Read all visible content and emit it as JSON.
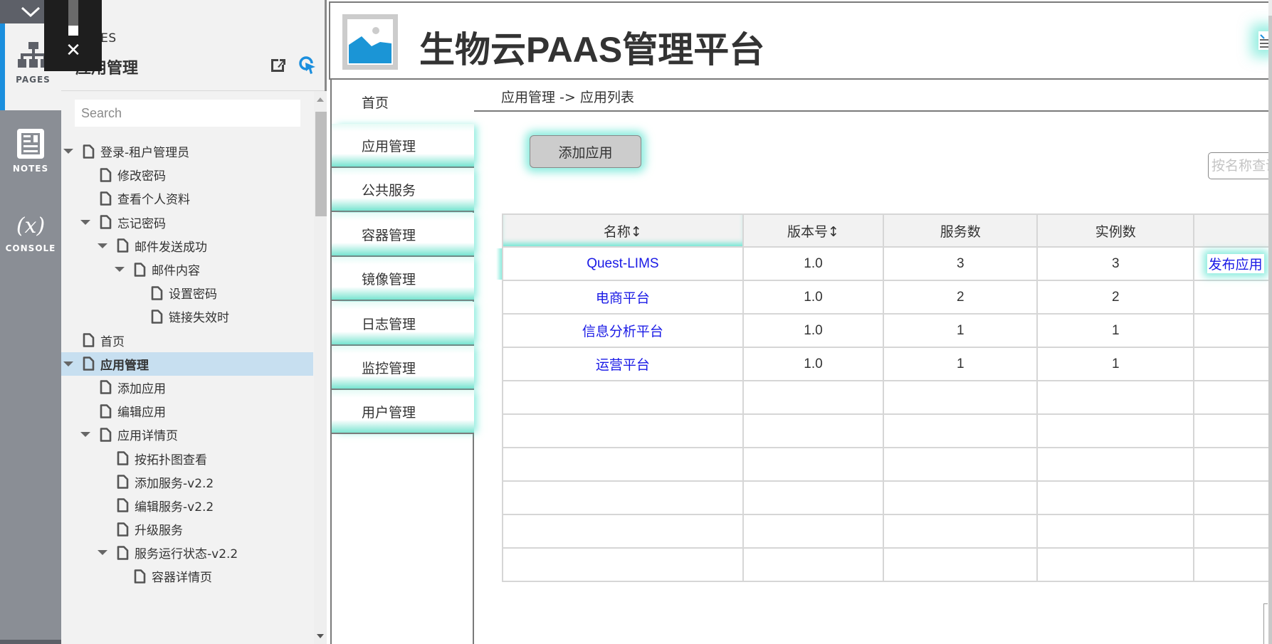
{
  "rail": {
    "tabs": [
      {
        "label": "PAGES",
        "icon": "sitemap-icon",
        "active": true
      },
      {
        "label": "NOTES",
        "icon": "notes-icon",
        "active": false
      },
      {
        "label": "CONSOLE",
        "icon": "variable-icon",
        "glyph": "(x)",
        "active": false
      }
    ]
  },
  "overlay": {
    "close_glyph": "✕"
  },
  "panel": {
    "kicker": "PAGES",
    "title": "应用管理",
    "search_placeholder": "Search",
    "tree": [
      {
        "label": "登录-租户管理员",
        "level": 0,
        "expanded": true
      },
      {
        "label": "修改密码",
        "level": 1
      },
      {
        "label": "查看个人资料",
        "level": 1
      },
      {
        "label": "忘记密码",
        "level": 1,
        "expanded": true
      },
      {
        "label": "邮件发送成功",
        "level": 2,
        "expanded": true
      },
      {
        "label": "邮件内容",
        "level": 3,
        "expanded": true
      },
      {
        "label": "设置密码",
        "level": 4
      },
      {
        "label": "链接失效时",
        "level": 4
      },
      {
        "label": "首页",
        "level": 0
      },
      {
        "label": "应用管理",
        "level": 0,
        "expanded": true,
        "selected": true
      },
      {
        "label": "添加应用",
        "level": 1
      },
      {
        "label": "编辑应用",
        "level": 1
      },
      {
        "label": "应用详情页",
        "level": 1,
        "expanded": true
      },
      {
        "label": "按拓扑图查看",
        "level": 2
      },
      {
        "label": "添加服务-v2.2",
        "level": 2
      },
      {
        "label": "编辑服务-v2.2",
        "level": 2
      },
      {
        "label": "升级服务",
        "level": 2
      },
      {
        "label": "服务运行状态-v2.2",
        "level": 2,
        "expanded": true
      },
      {
        "label": "容器详情页",
        "level": 3
      }
    ]
  },
  "app": {
    "title": "生物云PAAS管理平台",
    "nav": [
      {
        "label": "首页"
      },
      {
        "label": "应用管理"
      },
      {
        "label": "公共服务"
      },
      {
        "label": "容器管理"
      },
      {
        "label": "镜像管理"
      },
      {
        "label": "日志管理"
      },
      {
        "label": "监控管理"
      },
      {
        "label": "用户管理"
      }
    ],
    "breadcrumb": "应用管理 -> 应用列表",
    "add_button": "添加应用",
    "search_placeholder": "按名称查询",
    "table": {
      "columns": [
        "名称↕",
        "版本号↕",
        "服务数",
        "实例数",
        ""
      ],
      "rows": [
        {
          "name": "Quest-LIMS",
          "version": "1.0",
          "services": "3",
          "instances": "3",
          "action": "发布应用"
        },
        {
          "name": "电商平台",
          "version": "1.0",
          "services": "2",
          "instances": "2",
          "action": ""
        },
        {
          "name": "信息分析平台",
          "version": "1.0",
          "services": "1",
          "instances": "1",
          "action": ""
        },
        {
          "name": "运营平台",
          "version": "1.0",
          "services": "1",
          "instances": "1",
          "action": ""
        }
      ],
      "empty_rows": 6
    }
  },
  "colors": {
    "accent_blue": "#1b8fde",
    "link_blue": "#1a1ae6",
    "highlight_teal": "#40e0c8",
    "selected_row": "#c7dff0"
  }
}
